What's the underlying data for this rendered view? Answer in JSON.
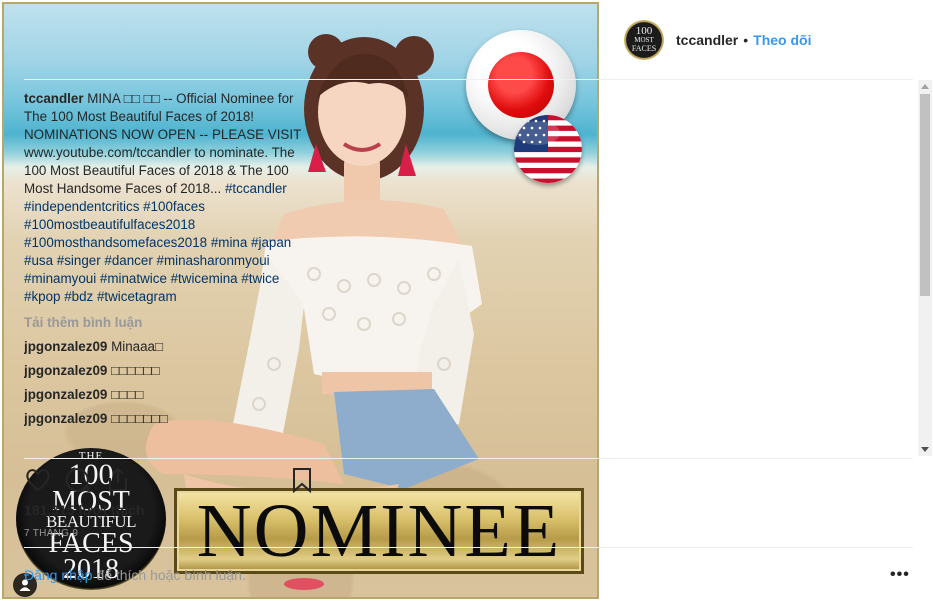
{
  "post": {
    "nominee_badge": {
      "the": "THE",
      "line1": "100",
      "line2": "MOST",
      "line3": "BEAUTIFUL",
      "line4": "FACES",
      "line5": "2018"
    },
    "nominee_text": "NOMINEE"
  },
  "header": {
    "avatar_text": [
      "100",
      "MOST",
      "FACES"
    ],
    "username": "tccandler",
    "separator": "•",
    "follow_label": "Theo dõi"
  },
  "caption": {
    "user": "tccandler",
    "text": "MINA □□ □□ -- Official Nominee for The 100 Most Beautiful Faces of 2018! NOMINATIONS NOW OPEN -- PLEASE VISIT www.youtube.com/tccandler to nominate. The 100 Most Beautiful Faces of 2018 & The 100 Most Handsome Faces of 2018...",
    "hashtags": "#tccandler #independentcritics #100faces #100mostbeautifulfaces2018 #100mosthandsomefaces2018 #mina #japan #usa #singer #dancer #minasharonmyoui #minamyoui #minatwice #twicemina #twice #kpop #bdz #twicetagram"
  },
  "load_more_label": "Tải thêm bình luận",
  "comments": [
    {
      "user": "jpgonzalez09",
      "text": "Minaaa□"
    },
    {
      "user": "jpgonzalez09",
      "text": "□□□□□□"
    },
    {
      "user": "jpgonzalez09",
      "text": "□□□□"
    },
    {
      "user": "jpgonzalez09",
      "text": "□□□□□□□"
    }
  ],
  "actions": {
    "icons": [
      "heart-icon",
      "comment-icon",
      "share-icon",
      "bookmark-icon"
    ]
  },
  "likes": "181,315 lượt thích",
  "date": "7 THÁNG 9",
  "footer": {
    "login_link": "Đăng nhập",
    "login_rest": " để thích hoặc bình luận.",
    "more": "•••"
  },
  "colors": {
    "link": "#3897f0",
    "hashtag": "#003569",
    "muted": "#999999",
    "text": "#262626"
  }
}
